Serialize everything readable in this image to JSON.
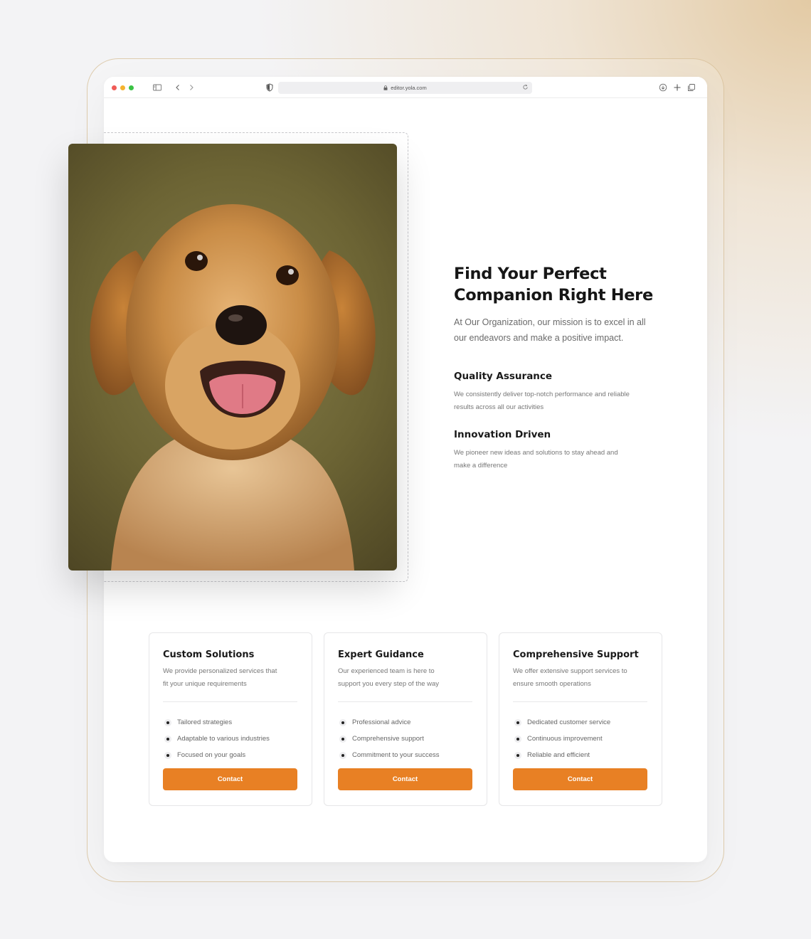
{
  "browser": {
    "url": "editor.yola.com"
  },
  "hero": {
    "title_line1": "Find Your Perfect",
    "title_line2": "Companion Right Here",
    "text_line1": "At Our Organization, our mission is to excel in all",
    "text_line2": "our endeavors and make a positive impact."
  },
  "features": [
    {
      "title": "Quality Assurance",
      "text_line1": "We consistently deliver top-notch performance and reliable",
      "text_line2": "results across all our activities"
    },
    {
      "title": "Innovation Driven",
      "text_line1": "We pioneer new ideas and solutions to stay ahead and",
      "text_line2": "make a difference"
    }
  ],
  "cards": [
    {
      "title": "Custom Solutions",
      "desc_line1": "We provide personalized services that",
      "desc_line2": "fit your unique requirements",
      "items": [
        "Tailored strategies",
        "Adaptable to various industries",
        "Focused on your goals"
      ],
      "button": "Contact"
    },
    {
      "title": "Expert Guidance",
      "desc_line1": "Our experienced team is here to",
      "desc_line2": "support you every step of the way",
      "items": [
        "Professional advice",
        "Comprehensive support",
        "Commitment to your success"
      ],
      "button": "Contact"
    },
    {
      "title": "Comprehensive Support",
      "desc_line1": "We offer extensive support services to",
      "desc_line2": "ensure smooth operations",
      "items": [
        "Dedicated customer service",
        "Continuous improvement",
        "Reliable and efficient"
      ],
      "button": "Contact"
    }
  ],
  "colors": {
    "accent": "#e88024",
    "heading": "#161616",
    "body_text": "#6a6a6a"
  },
  "icons": {
    "window_controls": [
      "close-dot",
      "minimize-dot",
      "zoom-dot"
    ],
    "toolbar": [
      "sidebar-icon",
      "back-icon",
      "forward-icon",
      "shield-icon",
      "lock-icon",
      "reload-icon",
      "download-icon",
      "new-tab-icon",
      "tabs-overview-icon"
    ],
    "list_bullet": "bullet-dot-icon"
  }
}
